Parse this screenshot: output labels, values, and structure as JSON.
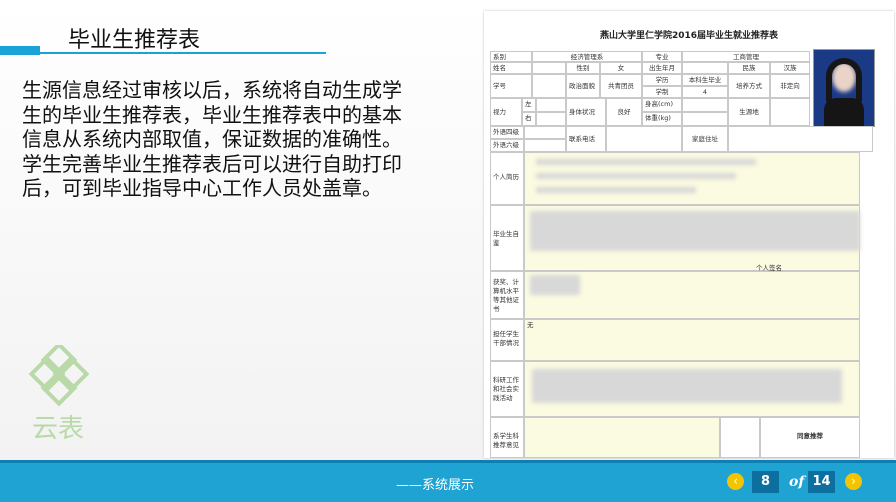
{
  "slide": {
    "title": "毕业生推荐表",
    "body": "生源信息经过审核以后，系统将自动生成学生的毕业生推荐表，毕业生推荐表中的基本信息从系统内部取值，保证数据的准确性。学生完善毕业生推荐表后可以进行自助打印后，可到毕业指导中心工作人员处盖章。",
    "logo_text": "云表"
  },
  "form": {
    "title": "燕山大学里仁学院2016届毕业生就业推荐表",
    "labels": {
      "department": "系别",
      "department_value": "经济管理系",
      "major": "专业",
      "major_value": "工商管理",
      "name": "姓名",
      "gender": "性别",
      "gender_value": "女",
      "birth": "出生年月",
      "ethnicity": "民族",
      "ethnicity_value": "汉族",
      "student_id": "学号",
      "politics": "政治面貌",
      "politics_value": "共青团员",
      "education": "学历",
      "education_value": "本科生毕业",
      "length": "学制",
      "length_value": "4",
      "training": "培养方式",
      "training_value": "非定向",
      "vision": "视力",
      "left": "左",
      "right": "右",
      "health": "身体状况",
      "health_value": "良好",
      "height": "身高(cm)",
      "weight": "体重(kg)",
      "origin": "生源地",
      "lang4": "外语四级",
      "lang6": "外语六级",
      "phone": "联系电话",
      "address": "家庭住址",
      "resume": "个人简历",
      "self_eval": "毕业生自鉴",
      "signature": "个人签名",
      "awards": "获奖、计算机水平等其他证书",
      "cadre": "担任学生干部情况",
      "cadre_value": "无",
      "research": "科研工作和社会实践活动",
      "dept_rec": "系学生科推荐意见",
      "agree": "同意推荐"
    }
  },
  "footer": {
    "label": "——系统展示",
    "current_page": "8",
    "of_label": "of",
    "total_pages": "14",
    "prev_icon": "chevron-left-icon",
    "next_icon": "chevron-right-icon"
  },
  "colors": {
    "accent": "#1ea3d3",
    "nav_button": "#f5c400",
    "page_box": "#0d6fa0",
    "form_fill": "#fbfbe1"
  }
}
